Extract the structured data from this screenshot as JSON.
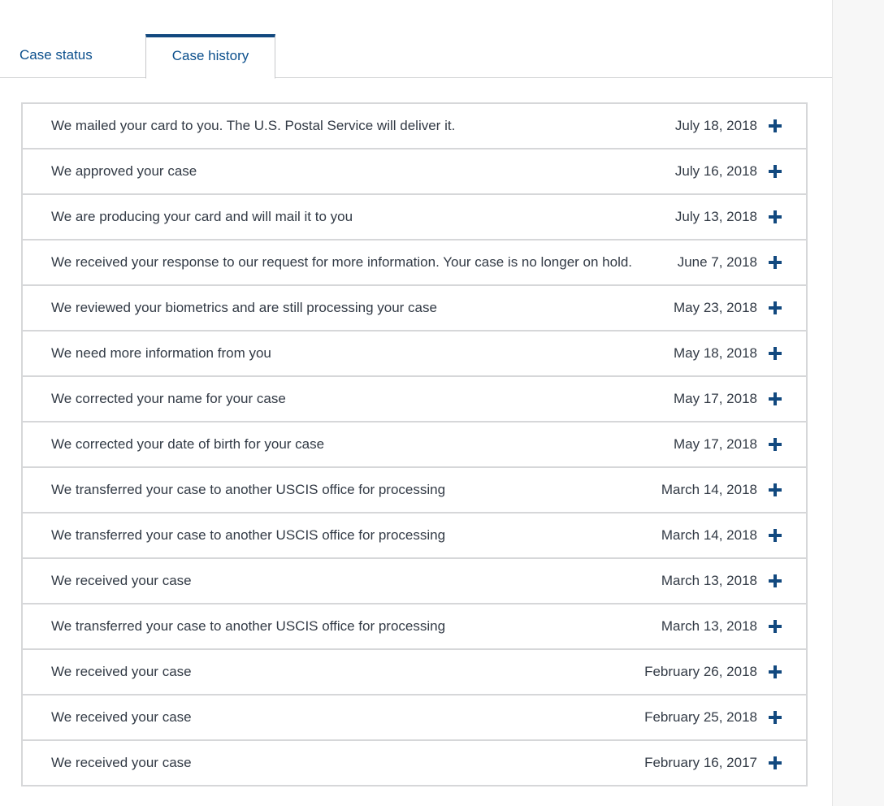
{
  "tabs": [
    {
      "label": "Case status",
      "active": false
    },
    {
      "label": "Case history",
      "active": true
    }
  ],
  "colors": {
    "accent": "#12497f",
    "tab_text": "#0b4f8c",
    "body_text": "#323a45",
    "border": "#d6d7d9"
  },
  "history": [
    {
      "text": "We mailed your card to you. The U.S. Postal Service will deliver it.",
      "date": "July 18, 2018"
    },
    {
      "text": "We approved your case",
      "date": "July 16, 2018"
    },
    {
      "text": "We are producing your card and will mail it to you",
      "date": "July 13, 2018"
    },
    {
      "text": "We received your response to our request for more information. Your case is no longer on hold.",
      "date": "June 7, 2018"
    },
    {
      "text": "We reviewed your biometrics and are still processing your case",
      "date": "May 23, 2018"
    },
    {
      "text": "We need more information from you",
      "date": "May 18, 2018"
    },
    {
      "text": "We corrected your name for your case",
      "date": "May 17, 2018"
    },
    {
      "text": "We corrected your date of birth for your case",
      "date": "May 17, 2018"
    },
    {
      "text": "We transferred your case to another USCIS office for processing",
      "date": "March 14, 2018"
    },
    {
      "text": "We transferred your case to another USCIS office for processing",
      "date": "March 14, 2018"
    },
    {
      "text": "We received your case",
      "date": "March 13, 2018"
    },
    {
      "text": "We transferred your case to another USCIS office for processing",
      "date": "March 13, 2018"
    },
    {
      "text": "We received your case",
      "date": "February 26, 2018"
    },
    {
      "text": "We received your case",
      "date": "February 25, 2018"
    },
    {
      "text": "We received your case",
      "date": "February 16, 2017"
    }
  ],
  "row_icon": "plus-icon"
}
